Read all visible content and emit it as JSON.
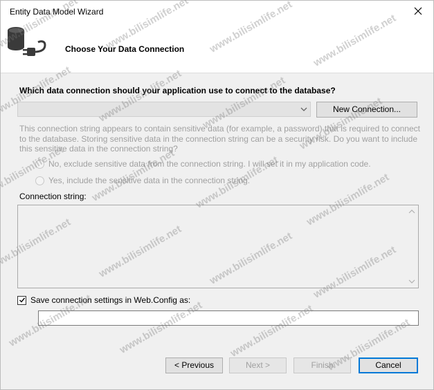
{
  "window": {
    "title": "Entity Data Model Wizard"
  },
  "header": {
    "title": "Choose Your Data Connection",
    "icon": "database-connect-icon"
  },
  "connection": {
    "question": "Which data connection should your application use to connect to the database?",
    "selected_value": "",
    "new_connection_label": "New Connection..."
  },
  "sensitive": {
    "text": "This connection string appears to contain sensitive data (for example, a password) that is required to connect to the database. Storing sensitive data in the connection string can be a security risk. Do you want to include this sensitive data in the connection string?",
    "option_exclude": "No, exclude sensitive data from the connection string. I will set it in my application code.",
    "option_include": "Yes, include the sensitive data in the connection string."
  },
  "connection_string": {
    "label": "Connection string:",
    "value": ""
  },
  "save_settings": {
    "label": "Save connection settings in Web.Config as:",
    "checked": true,
    "value": ""
  },
  "buttons": {
    "previous": "< Previous",
    "next": "Next >",
    "finish": "Finish",
    "cancel": "Cancel"
  },
  "watermark": {
    "text": "www.bilisimlife.net"
  },
  "colors": {
    "header_bg": "#ffffff",
    "dialog_bg": "#f0f0f0",
    "disabled_text": "#a0a0a0",
    "accent": "#0078d7"
  }
}
